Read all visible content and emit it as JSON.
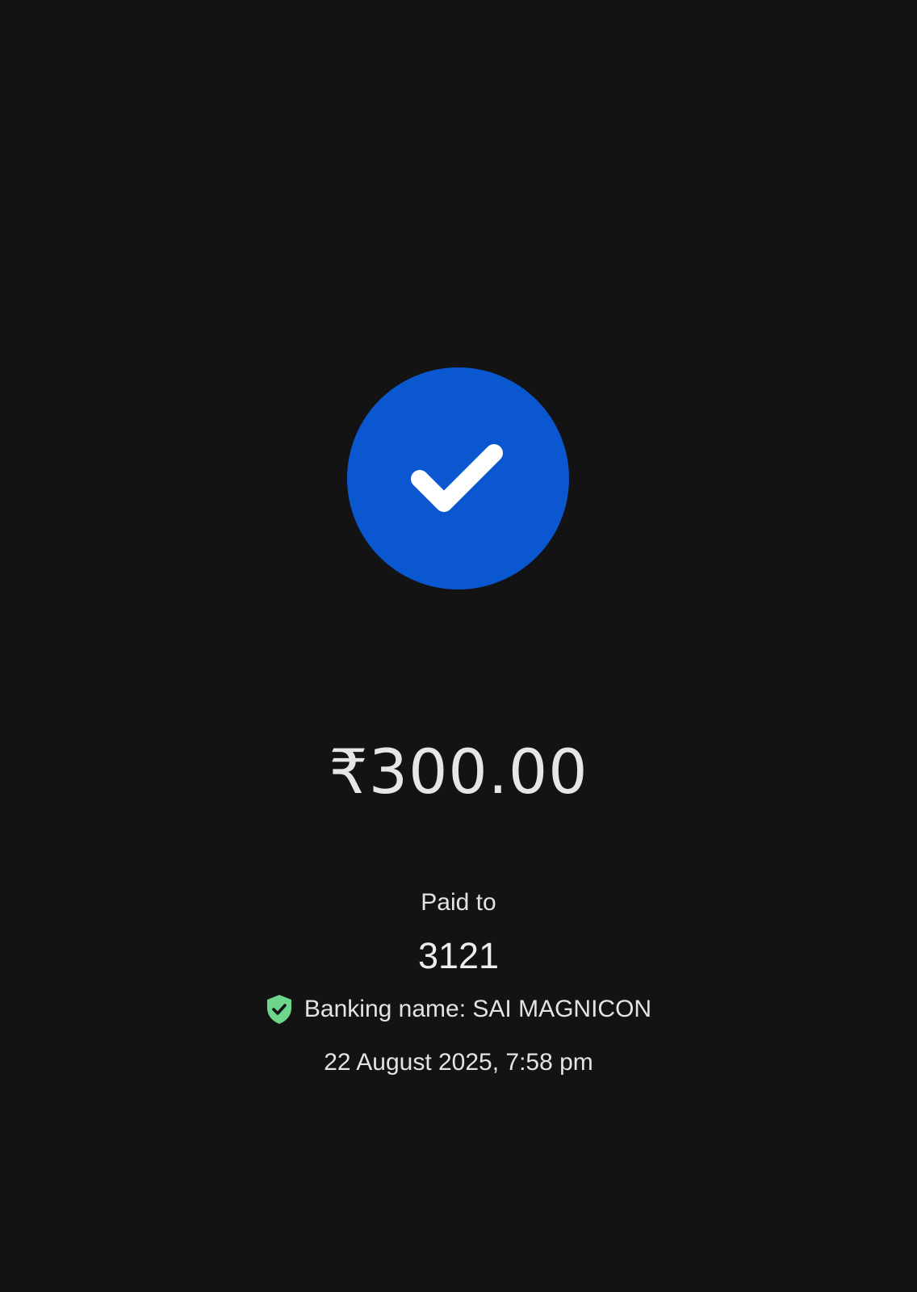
{
  "status": {
    "icon": "check-icon",
    "circle_color": "#0b57d0"
  },
  "payment": {
    "amount": "₹300.00",
    "paid_to_label": "Paid to",
    "payee": "3121",
    "banking_name": "Banking name: SAI MAGNICON",
    "verified_icon": "verified-shield-icon",
    "verified_color": "#6dd58c",
    "datetime": "22 August 2025, 7:58 pm"
  }
}
